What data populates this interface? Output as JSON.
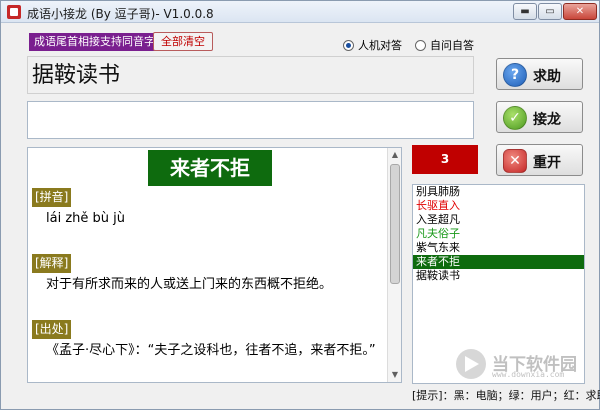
{
  "window": {
    "title": "成语小接龙 (By 逗子哥)- V1.0.0.8",
    "min_glyph": "▬",
    "max_glyph": "▭",
    "close_glyph": "✕"
  },
  "toolbar": {
    "mode_label": "成语尾首相接支持同音字",
    "clear_button": "全部清空",
    "radio_vs_computer": "人机对答",
    "radio_self": "自问自答",
    "selected_mode": "人机对答"
  },
  "current_idiom": "据鞍读书",
  "input": {
    "value": ""
  },
  "detail": {
    "word": "来者不拒",
    "pinyin_label": "[拼音]",
    "pinyin": "lái zhě bù jù",
    "meaning_label": "[解释]",
    "meaning": "对于有所求而来的人或送上门来的东西概不拒绝。",
    "source_label": "[出处]",
    "source": "《孟子·尽心下》：“夫子之设科也，往者不追，来者不拒。”"
  },
  "buttons": {
    "help": {
      "label": "求助",
      "icon": "question-icon"
    },
    "chain": {
      "label": "接龙",
      "icon": "check-icon"
    },
    "restart": {
      "label": "重开",
      "icon": "close-icon"
    }
  },
  "count": "3",
  "history": [
    {
      "text": "别具肺肠",
      "color": "#000000",
      "selected": false
    },
    {
      "text": "长驱直入",
      "color": "#e00000",
      "selected": false
    },
    {
      "text": "入圣超凡",
      "color": "#000000",
      "selected": false
    },
    {
      "text": "凡夫俗子",
      "color": "#1a9a1a",
      "selected": false
    },
    {
      "text": "紫气东来",
      "color": "#000000",
      "selected": false
    },
    {
      "text": "来者不拒",
      "color": "#ffffff",
      "selected": true
    },
    {
      "text": "据鞍读书",
      "color": "#000000",
      "selected": false
    }
  ],
  "hint": "[提示]：黑：电脑；绿：用户；红：求助",
  "watermark": {
    "text": "当下软件园",
    "sub": "www.downxia.com"
  },
  "colors": {
    "accent_green": "#0e6b0e",
    "count_red": "#c00000",
    "mode_purple": "#7a1f8f",
    "section_olive": "#8a7a1e"
  }
}
